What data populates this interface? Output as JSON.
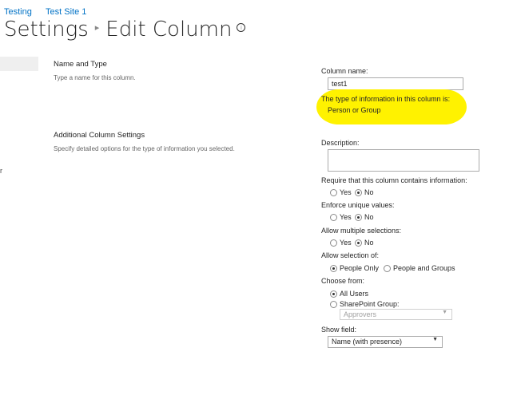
{
  "breadcrumb": {
    "items": [
      "Testing",
      "Test Site 1"
    ]
  },
  "header": {
    "title_part1": "Settings",
    "separator": "▸",
    "title_part2": "Edit Column",
    "info_symbol": "i"
  },
  "left_nav": {
    "partial_text": "r"
  },
  "sections": {
    "name_type": {
      "title": "Name and Type",
      "description": "Type a name for this column."
    },
    "additional": {
      "title": "Additional Column Settings",
      "description": "Specify detailed options for the type of information you selected."
    }
  },
  "form": {
    "column_name_label": "Column name:",
    "column_name_value": "test1",
    "type_label": "The type of information in this column is:",
    "type_value": "Person or Group",
    "highlight_color": "#fff200",
    "description_label": "Description:",
    "description_value": "",
    "require": {
      "label": "Require that this column contains information:",
      "options": [
        "Yes",
        "No"
      ],
      "selected": "No"
    },
    "unique": {
      "label": "Enforce unique values:",
      "options": [
        "Yes",
        "No"
      ],
      "selected": "No"
    },
    "multiple": {
      "label": "Allow multiple selections:",
      "options": [
        "Yes",
        "No"
      ],
      "selected": "No"
    },
    "allow_selection": {
      "label": "Allow selection of:",
      "options": [
        "People Only",
        "People and Groups"
      ],
      "selected": "People Only"
    },
    "choose_from": {
      "label": "Choose from:",
      "options": [
        "All Users",
        "SharePoint Group:"
      ],
      "selected": "All Users",
      "group_value": "Approvers"
    },
    "show_field": {
      "label": "Show field:",
      "value": "Name (with presence)"
    }
  },
  "colors": {
    "link": "#0072c6",
    "title": "#262626"
  }
}
